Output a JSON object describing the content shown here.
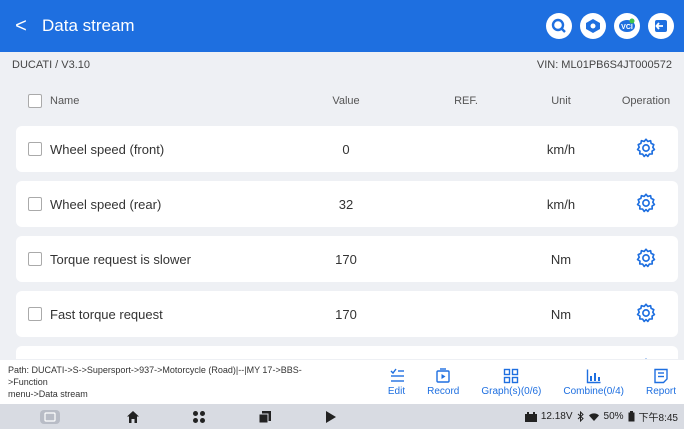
{
  "header": {
    "back_glyph": "<",
    "title": "Data stream"
  },
  "top_icons": [
    "search-icon",
    "vehicle-icon",
    "vci-icon",
    "exit-icon"
  ],
  "info": {
    "path_short": "DUCATI / V3.10",
    "vin": "VIN: ML01PB6S4JT000572"
  },
  "columns": {
    "name": "Name",
    "value": "Value",
    "ref": "REF.",
    "unit": "Unit",
    "operation": "Operation"
  },
  "rows": [
    {
      "name": "Wheel speed (front)",
      "value": "0",
      "ref": "",
      "unit": "km/h"
    },
    {
      "name": "Wheel speed (rear)",
      "value": "32",
      "ref": "",
      "unit": "km/h"
    },
    {
      "name": "Torque request is slower",
      "value": "170",
      "ref": "",
      "unit": "Nm"
    },
    {
      "name": "Fast torque request",
      "value": "170",
      "ref": "",
      "unit": "Nm"
    }
  ],
  "path": {
    "line1": "Path:  DUCATI->S->Supersport->937->Motorcycle (Road)|--|MY 17->BBS->Function",
    "line2": "menu->Data stream"
  },
  "actions": {
    "edit": "Edit",
    "record": "Record",
    "graph": "Graph(s)(0/6)",
    "combine": "Combine(0/4)",
    "report": "Report"
  },
  "status": {
    "voltage": "12.18V",
    "battery": "50%",
    "time": "下午8:45"
  },
  "colors": {
    "accent": "#1e6fe0",
    "background": "#eef0f4"
  }
}
